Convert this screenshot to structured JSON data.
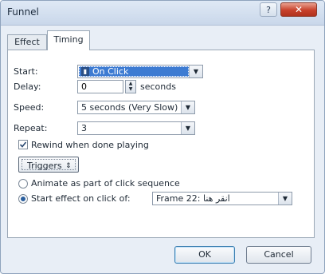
{
  "window": {
    "title": "Funnel",
    "help_label": "?",
    "close_label": "✕"
  },
  "tabs": [
    {
      "label": "Effect",
      "active": false
    },
    {
      "label": "Timing",
      "active": true
    }
  ],
  "timing": {
    "start_label": "Start:",
    "start_value": "On Click",
    "delay_label": "Delay:",
    "delay_value": "0",
    "delay_unit": "seconds",
    "speed_label": "Speed:",
    "speed_value": "5 seconds (Very Slow)",
    "repeat_label": "Repeat:",
    "repeat_value": "3",
    "rewind_label": "Rewind when done playing",
    "rewind_checked": true
  },
  "triggers": {
    "button_label": "Triggers",
    "animate_label": "Animate as part of click sequence",
    "start_effect_label": "Start effect on click of:",
    "shape_value": "Frame 22: انقر هنا",
    "selected_option": "start_effect"
  },
  "footer": {
    "ok_label": "OK",
    "cancel_label": "Cancel"
  },
  "icons": {
    "dropdown": "chevron-down-icon",
    "spinner": "spinner-arrows-icon",
    "triggers_chevron": "double-chevron-icon",
    "start_item": "mouse-click-icon"
  },
  "colors": {
    "selection": "#3d7bd2",
    "close_button": "#c8412b",
    "title_bar": "#c9d7ea"
  }
}
